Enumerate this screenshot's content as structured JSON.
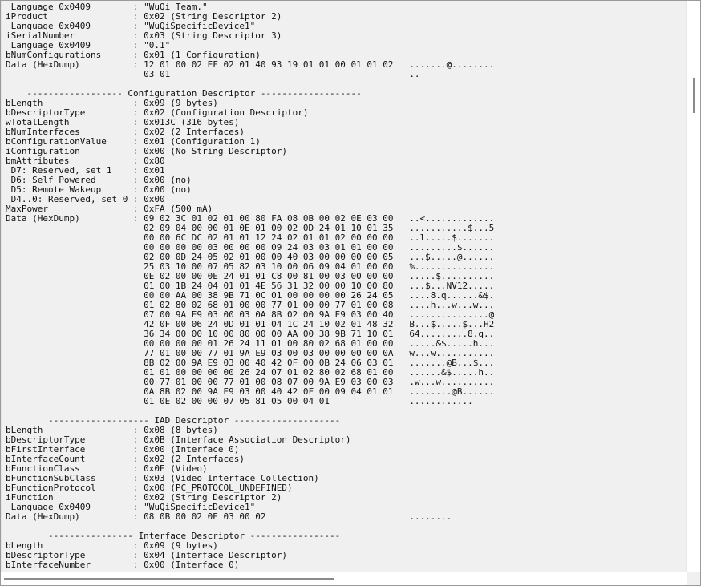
{
  "dump_text": " Language 0x0409        : \"WuQi Team.\"\niProduct                : 0x02 (String Descriptor 2)\n Language 0x0409        : \"WuQiSpecificDevice1\"\niSerialNumber           : 0x03 (String Descriptor 3)\n Language 0x0409        : \"0.1\"\nbNumConfigurations      : 0x01 (1 Configuration)\nData (HexDump)          : 12 01 00 02 EF 02 01 40 93 19 01 01 00 01 01 02   .......@........\n                          03 01                                             ..\n\n    ------------------ Configuration Descriptor -------------------\nbLength                 : 0x09 (9 bytes)\nbDescriptorType         : 0x02 (Configuration Descriptor)\nwTotalLength            : 0x013C (316 bytes)\nbNumInterfaces          : 0x02 (2 Interfaces)\nbConfigurationValue     : 0x01 (Configuration 1)\niConfiguration          : 0x00 (No String Descriptor)\nbmAttributes            : 0x80\n D7: Reserved, set 1    : 0x01\n D6: Self Powered       : 0x00 (no)\n D5: Remote Wakeup      : 0x00 (no)\n D4..0: Reserved, set 0 : 0x00\nMaxPower                : 0xFA (500 mA)\nData (HexDump)          : 09 02 3C 01 02 01 00 80 FA 08 0B 00 02 0E 03 00   ..<.............\n                          02 09 04 00 00 01 0E 01 00 02 0D 24 01 10 01 35   ...........$...5\n                          00 00 6C DC 02 01 01 12 24 02 01 01 02 00 00 00   ..l.....$.......\n                          00 00 00 00 03 00 00 00 09 24 03 03 01 01 00 00   .........$......\n                          02 00 0D 24 05 02 01 00 00 40 03 00 00 00 00 05   ...$.....@......\n                          25 03 10 00 07 05 82 03 10 00 06 09 04 01 00 00   %...............\n                          0E 02 00 00 0E 24 01 01 C8 00 81 00 03 00 00 00   .....$..........\n                          01 00 1B 24 04 01 01 4E 56 31 32 00 00 10 00 80   ...$...NV12.....\n                          00 00 AA 00 38 9B 71 0C 01 00 00 00 00 26 24 05   ....8.q......&$.\n                          01 02 80 02 68 01 00 00 77 01 00 00 77 01 00 08   ....h...w...w...\n                          07 00 9A E9 03 00 03 0A 8B 02 00 9A E9 03 00 40   ...............@\n                          42 0F 00 06 24 0D 01 01 04 1C 24 10 02 01 48 32   B...$.....$...H2\n                          36 34 00 00 10 00 80 00 00 AA 00 38 9B 71 10 01   64.........8.q..\n                          00 00 00 00 01 26 24 11 01 00 80 02 68 01 00 00   .....&$.....h...\n                          77 01 00 00 77 01 9A E9 03 00 03 00 00 00 00 0A   w...w...........\n                          8B 02 00 9A E9 03 00 40 42 0F 00 0B 24 06 03 01   .......@B...$...\n                          01 01 00 00 00 00 26 24 07 01 02 80 02 68 01 00   ......&$.....h..\n                          00 77 01 00 00 77 01 00 08 07 00 9A E9 03 00 03   .w...w..........\n                          0A 8B 02 00 9A E9 03 00 40 42 0F 00 09 04 01 01   ........@B......\n                          01 0E 02 00 00 07 05 81 05 00 04 01               ............\n\n        ------------------- IAD Descriptor --------------------\nbLength                 : 0x08 (8 bytes)\nbDescriptorType         : 0x0B (Interface Association Descriptor)\nbFirstInterface         : 0x00 (Interface 0)\nbInterfaceCount         : 0x02 (2 Interfaces)\nbFunctionClass          : 0x0E (Video)\nbFunctionSubClass       : 0x03 (Video Interface Collection)\nbFunctionProtocol       : 0x00 (PC_PROTOCOL_UNDEFINED)\niFunction               : 0x02 (String Descriptor 2)\n Language 0x0409        : \"WuQiSpecificDevice1\"\nData (HexDump)          : 08 0B 00 02 0E 03 00 02                           ........\n\n        ---------------- Interface Descriptor -----------------\nbLength                 : 0x09 (9 bytes)\nbDescriptorType         : 0x04 (Interface Descriptor)\nbInterfaceNumber        : 0x00 (Interface 0)"
}
